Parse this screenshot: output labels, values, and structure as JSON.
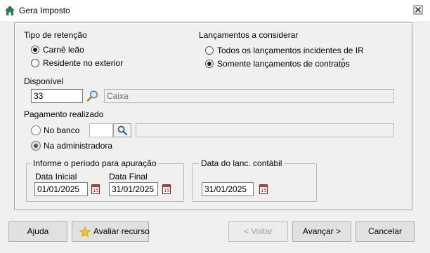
{
  "window": {
    "title": "Gera Imposto",
    "home_icon": "home-icon",
    "close_icon": "close-icon"
  },
  "retencao": {
    "label": "Tipo de retenção",
    "options": [
      {
        "label": "Carnê leão",
        "selected": true
      },
      {
        "label": "Residente no exterior",
        "selected": false
      }
    ]
  },
  "lancamentos": {
    "label": "Lançamentos a considerar",
    "options": [
      {
        "label": "Todos os lançamentos incidentes de IR",
        "selected": false
      },
      {
        "label": "Somente lançamentos de contratos",
        "selected": true
      }
    ],
    "info_icon": "info-icon"
  },
  "disponivel": {
    "label": "Disponível",
    "code": "33",
    "description": "Caixa",
    "search_icon": "search-icon"
  },
  "pagamento": {
    "label": "Pagamento realizado",
    "options": [
      {
        "label": "No banco",
        "selected": false
      },
      {
        "label": "Na administradora",
        "selected": true
      }
    ],
    "bank_code": "",
    "bank_name": ""
  },
  "periodo": {
    "label": "Informe o período para apuração",
    "start_label": "Data Inicial",
    "start_value": "01/01/2025",
    "end_label": "Data Final",
    "end_value": "31/01/2025"
  },
  "contabil": {
    "label": "Data do lanc. contábil",
    "value": "31/01/2025"
  },
  "calendar_glyph": "15",
  "buttons": {
    "help": "Ajuda",
    "rate": "Avaliar recurso",
    "back": "< Voltar",
    "next": "Avançar >",
    "cancel": "Cancelar"
  }
}
